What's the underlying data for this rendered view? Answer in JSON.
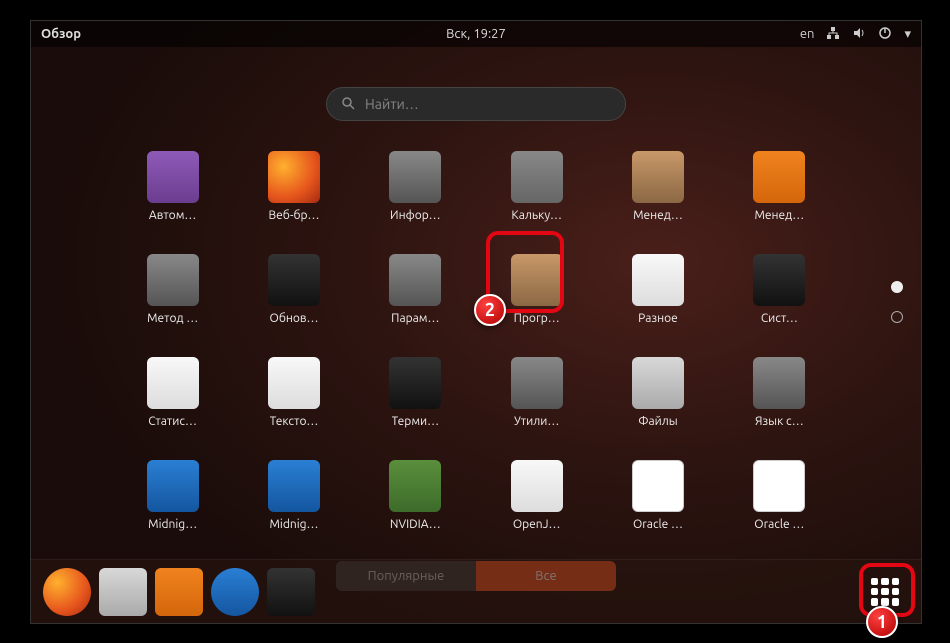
{
  "topbar": {
    "activities": "Обзор",
    "clock": "Вск, 19:27",
    "lang": "en"
  },
  "search": {
    "placeholder": "Найти…"
  },
  "apps": [
    {
      "label": "Автом…",
      "icon": "ic-purple",
      "name": "app-autostart"
    },
    {
      "label": "Веб-бр…",
      "icon": "ic-firefox",
      "name": "app-firefox"
    },
    {
      "label": "Инфор…",
      "icon": "ic-gray",
      "name": "app-info"
    },
    {
      "label": "Кальку…",
      "icon": "ic-calc",
      "name": "app-calculator"
    },
    {
      "label": "Менед…",
      "icon": "ic-box",
      "name": "app-package-manager"
    },
    {
      "label": "Менед…",
      "icon": "ic-orange",
      "name": "app-software-manager"
    },
    {
      "label": "Метод …",
      "icon": "ic-gray",
      "name": "app-input-methods"
    },
    {
      "label": "Обнов…",
      "icon": "ic-dark",
      "name": "app-updates"
    },
    {
      "label": "Парам…",
      "icon": "ic-gray",
      "name": "app-settings"
    },
    {
      "label": "Прогр…",
      "icon": "ic-box",
      "name": "app-software-sources"
    },
    {
      "label": "Разное",
      "icon": "ic-white",
      "name": "app-misc"
    },
    {
      "label": "Сист…",
      "icon": "ic-dark",
      "name": "app-system-monitor"
    },
    {
      "label": "Статис…",
      "icon": "ic-white",
      "name": "app-statistics"
    },
    {
      "label": "Тексто…",
      "icon": "ic-white",
      "name": "app-text-editor"
    },
    {
      "label": "Терми…",
      "icon": "ic-dark",
      "name": "app-terminal"
    },
    {
      "label": "Утили…",
      "icon": "ic-gray",
      "name": "app-utilities"
    },
    {
      "label": "Файлы",
      "icon": "ic-files",
      "name": "app-files"
    },
    {
      "label": "Язык с…",
      "icon": "ic-gray",
      "name": "app-language"
    },
    {
      "label": "Midnig…",
      "icon": "ic-blue",
      "name": "app-midnight-1"
    },
    {
      "label": "Midnig…",
      "icon": "ic-blue",
      "name": "app-midnight-2"
    },
    {
      "label": "NVIDIA…",
      "icon": "ic-green",
      "name": "app-nvidia"
    },
    {
      "label": "OpenJ…",
      "icon": "ic-white",
      "name": "app-openjdk"
    },
    {
      "label": "Oracle …",
      "icon": "ic-java",
      "name": "app-oracle-1"
    },
    {
      "label": "Oracle …",
      "icon": "ic-java",
      "name": "app-oracle-2"
    }
  ],
  "tabs": {
    "popular": "Популярные",
    "all": "Все"
  },
  "dock": [
    {
      "name": "dock-firefox",
      "icon": "ic-firefox"
    },
    {
      "name": "dock-files",
      "icon": "ic-files"
    },
    {
      "name": "dock-software",
      "icon": "ic-orange"
    },
    {
      "name": "dock-help",
      "icon": "ic-blue"
    },
    {
      "name": "dock-monitor",
      "icon": "ic-dark"
    }
  ],
  "annotations": {
    "badge1": "1",
    "badge2": "2"
  }
}
